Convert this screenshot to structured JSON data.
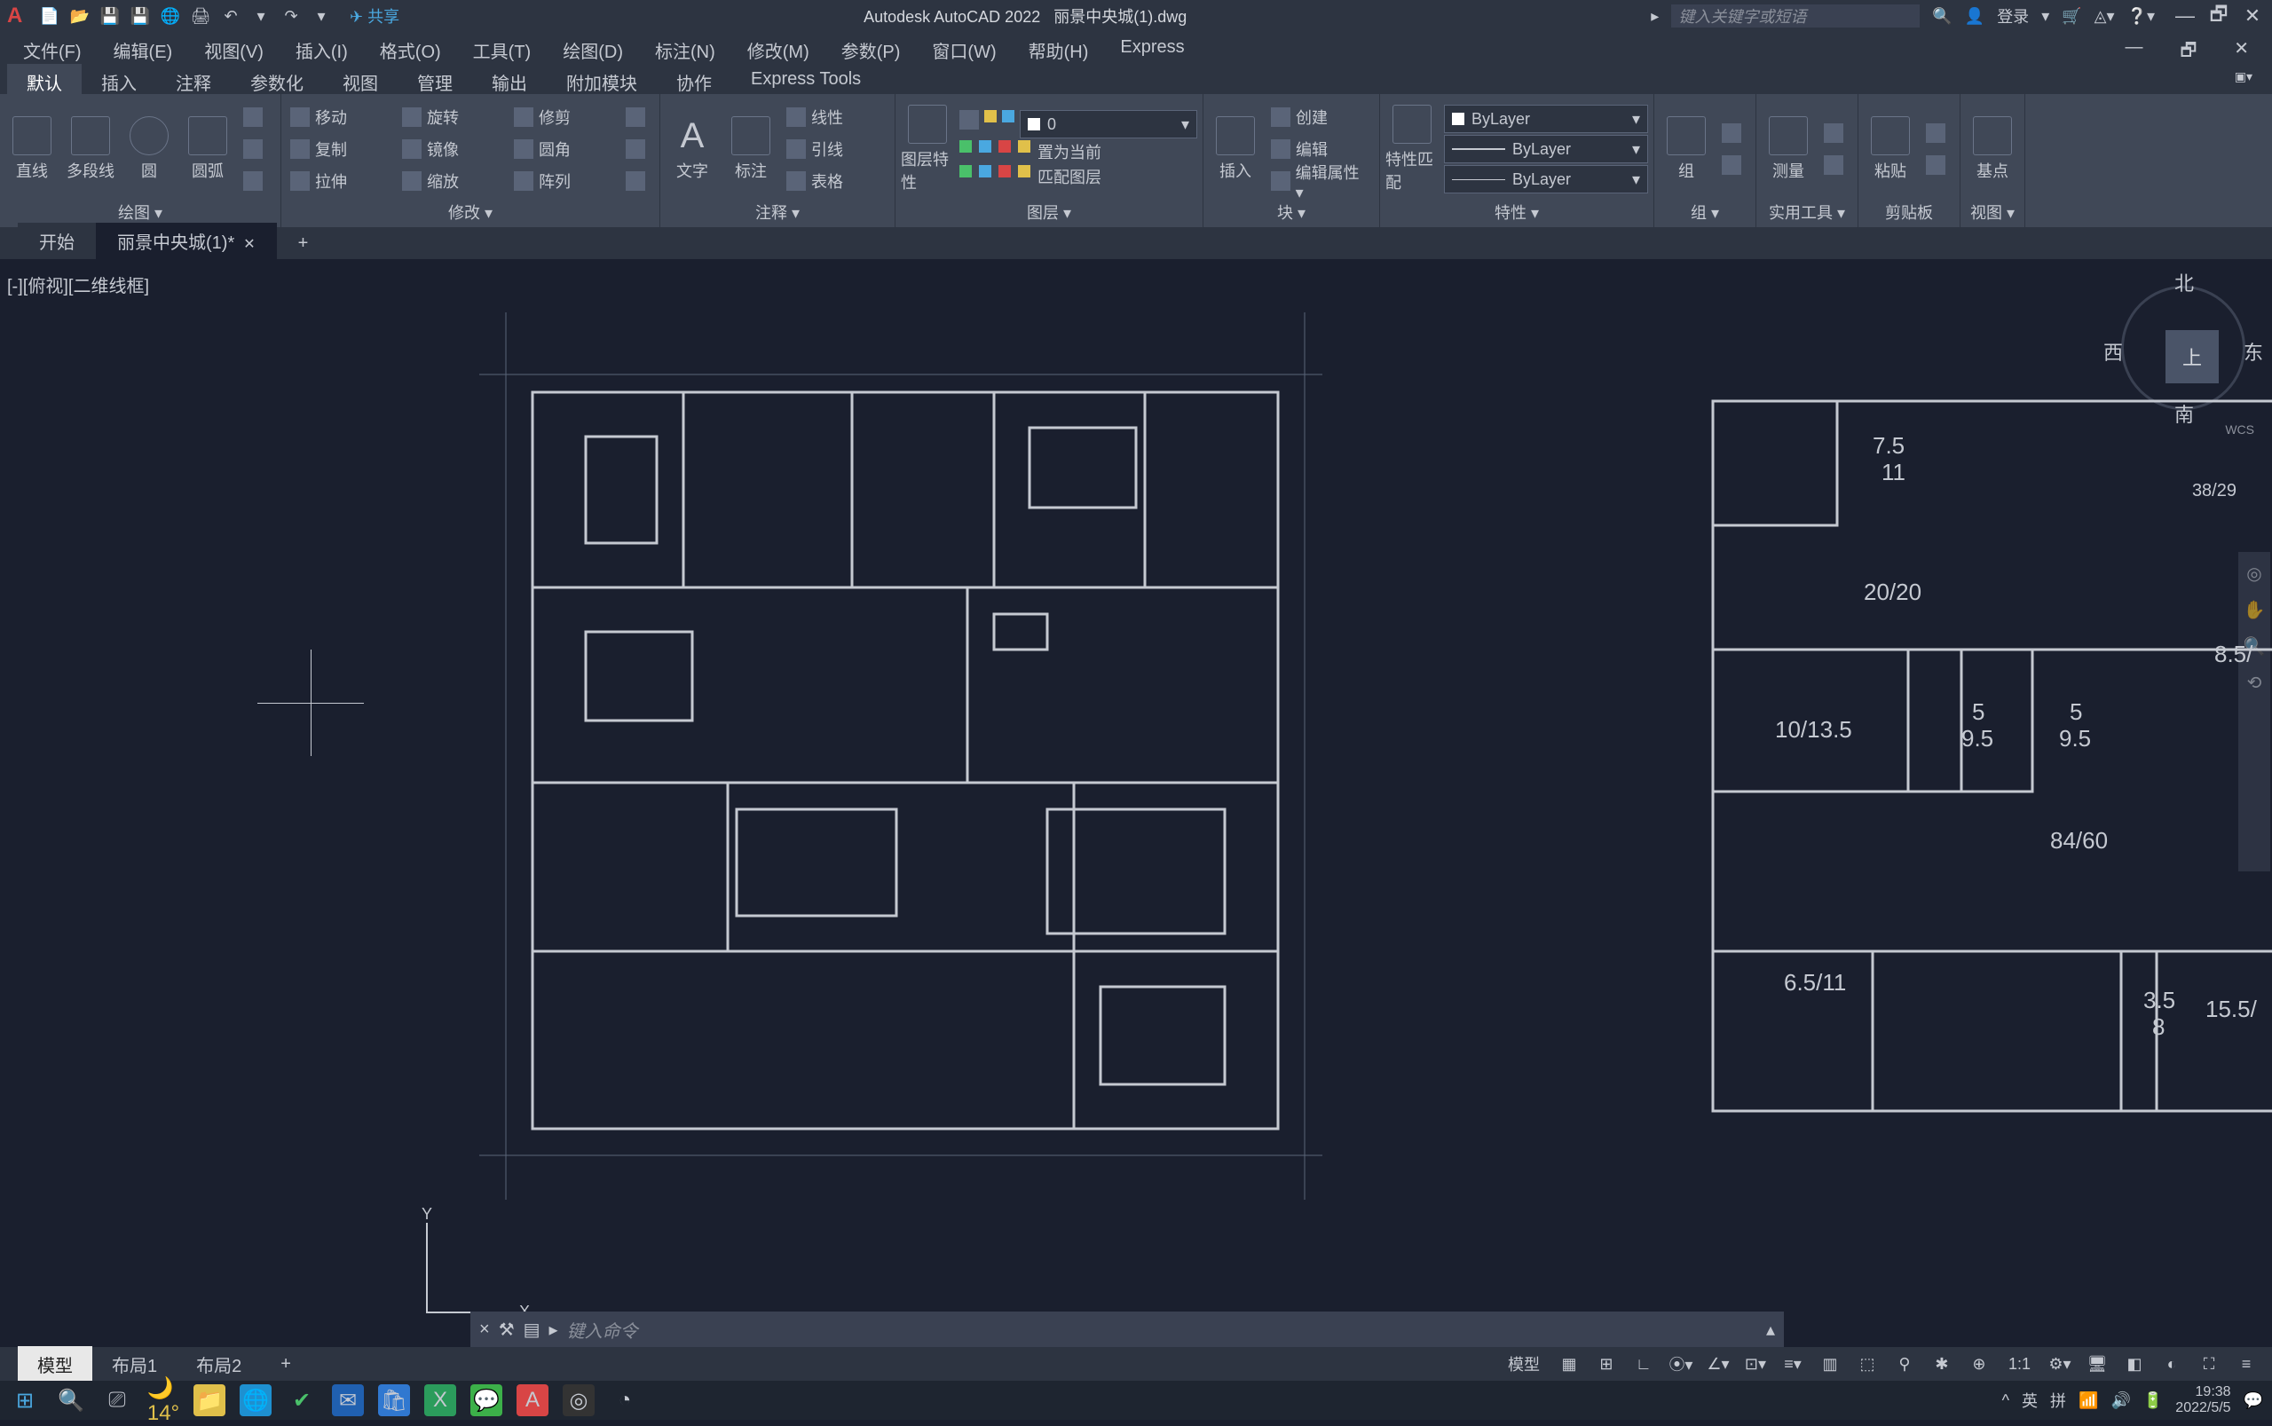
{
  "title": {
    "app": "Autodesk AutoCAD 2022",
    "file": "丽景中央城(1).dwg"
  },
  "qat_share": "共享",
  "searchbox_placeholder": "键入关键字或短语",
  "login_label": "登录",
  "menu": {
    "file": "文件(F)",
    "edit": "编辑(E)",
    "view": "视图(V)",
    "insert": "插入(I)",
    "format": "格式(O)",
    "tools": "工具(T)",
    "draw": "绘图(D)",
    "dim": "标注(N)",
    "modify": "修改(M)",
    "param": "参数(P)",
    "window": "窗口(W)",
    "help": "帮助(H)",
    "express": "Express"
  },
  "ribbontabs": {
    "default": "默认",
    "insert": "插入",
    "annotate": "注释",
    "param": "参数化",
    "view": "视图",
    "manage": "管理",
    "output": "输出",
    "addon": "附加模块",
    "collab": "协作",
    "expresstools": "Express Tools"
  },
  "ribbon": {
    "draw": {
      "label": "绘图 ▾",
      "line": "直线",
      "polyline": "多段线",
      "circle": "圆",
      "arc": "圆弧"
    },
    "modify": {
      "label": "修改 ▾",
      "move": "移动",
      "copy": "复制",
      "stretch": "拉伸",
      "rotate": "旋转",
      "mirror": "镜像",
      "scale": "缩放",
      "trim": "修剪",
      "fillet": "圆角",
      "array": "阵列"
    },
    "annotate": {
      "label": "注释 ▾",
      "text": "文字",
      "dim": "标注",
      "linear": "线性",
      "leader": "引线",
      "table": "表格"
    },
    "layer": {
      "label": "图层 ▾",
      "props": "图层特性",
      "value": "0",
      "setcurrent": "置为当前",
      "match": "匹配图层"
    },
    "block": {
      "label": "块 ▾",
      "insert": "插入",
      "create": "创建",
      "edit": "编辑",
      "editattr": "编辑属性 ▾"
    },
    "props": {
      "label": "特性 ▾",
      "match": "特性匹配",
      "bylayer": "ByLayer"
    },
    "group": {
      "label": "组 ▾",
      "group": "组"
    },
    "util": {
      "label": "实用工具 ▾",
      "measure": "测量"
    },
    "clip": {
      "label": "剪贴板",
      "paste": "粘贴"
    },
    "viewp": {
      "label": "视图 ▾",
      "base": "基点"
    }
  },
  "doctabs": {
    "start": "开始",
    "active": "丽景中央城(1)*"
  },
  "viewport_label": "[-][俯视][二维线框]",
  "viewcube": {
    "n": "北",
    "s": "南",
    "e": "东",
    "w": "西",
    "top": "上",
    "wcs": "WCS",
    "coord": "38/29"
  },
  "ucs": {
    "x": "X",
    "y": "Y"
  },
  "plan2_labels": {
    "r1": "7.5",
    "r1b": "11",
    "r2": "20/20",
    "r3": "10/13.5",
    "r4a": "5",
    "r4b": "9.5",
    "r5a": "5",
    "r5b": "9.5",
    "r6": "84/60",
    "r7": "6.5/11",
    "r8a": "3.5",
    "r8b": "8",
    "r9": "8.5/",
    "r10": "15.5/"
  },
  "cmdline": {
    "x": "×",
    "tool": "⚒",
    "icon": "▤",
    "prompt": "键入命令"
  },
  "layouttabs": {
    "model": "模型",
    "l1": "布局1",
    "l2": "布局2",
    "add": "+"
  },
  "statusbar": {
    "model": "模型",
    "scale": "1:1"
  },
  "taskbar": {
    "ime1": "英",
    "ime2": "拼",
    "time": "19:38",
    "date": "2022/5/5"
  }
}
